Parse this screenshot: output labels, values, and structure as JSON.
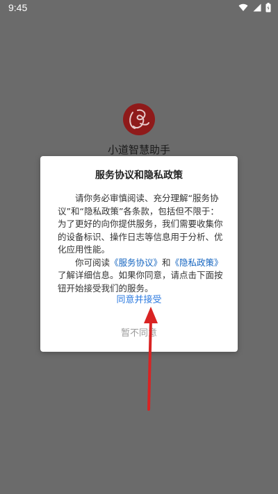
{
  "status_bar": {
    "time": "9:45"
  },
  "app": {
    "name": "小道智慧助手",
    "logo_color": "#9b1c1c"
  },
  "dialog": {
    "title": "服务协议和隐私政策",
    "para1": "请你务必审慎阅读、充分理解“服务协议”和“隐私政策”各条款，包括但不限于：为了更好的向你提供服务，我们需要收集你的设备标识、操作日志等信息用于分析、优化应用性能。",
    "para2_prefix": "你可阅读",
    "service_link": "《服务协议》",
    "para2_and": "和",
    "privacy_link": "《隐私政策》",
    "para2_suffix": "了解详细信息。如果你同意，请点击下面按钮开始接受我们的服务。",
    "accept_label": "同意并接受",
    "decline_label": "暂不同意"
  },
  "colors": {
    "overlay": "#6b6b6b",
    "accent": "#2d7be0",
    "link": "#1565c0",
    "annotation_arrow": "#d92323"
  },
  "icons": [
    "wifi-icon",
    "signal-icon",
    "battery-icon"
  ]
}
